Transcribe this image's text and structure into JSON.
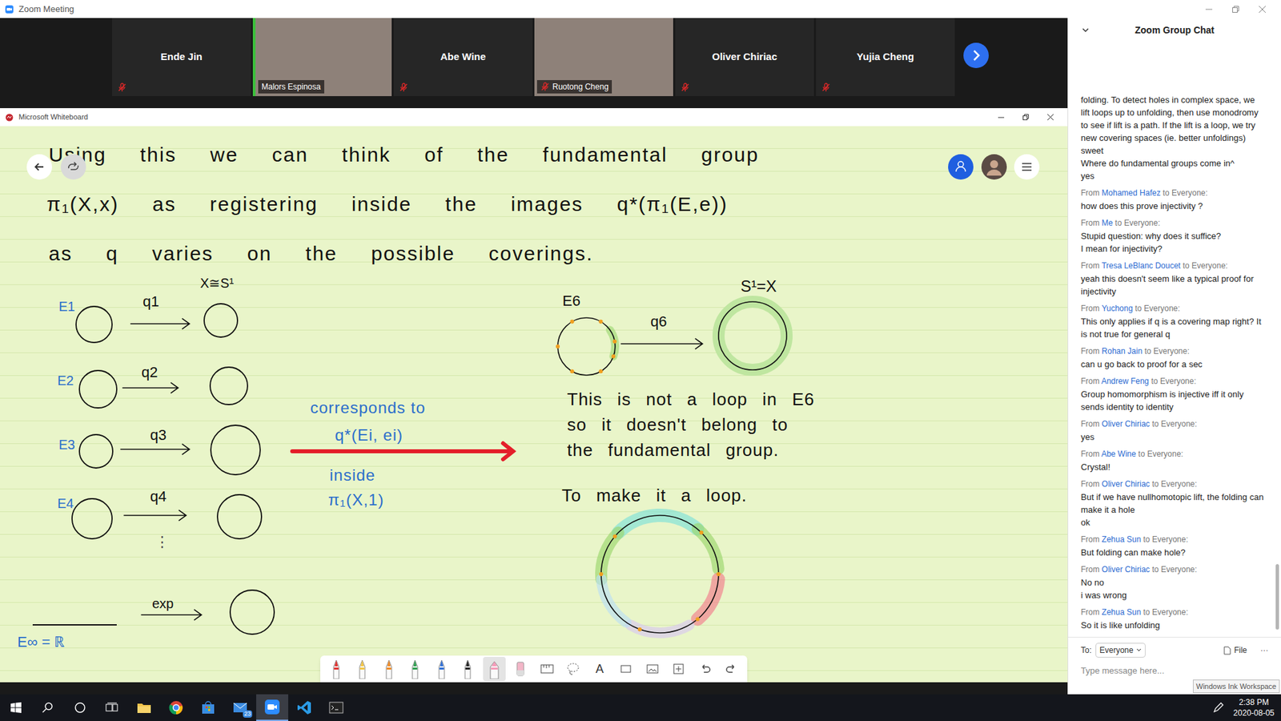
{
  "window": {
    "title": "Zoom Meeting"
  },
  "participants": [
    {
      "name": "Ende Jin",
      "kind": "name",
      "muted": true,
      "active_speaker": false
    },
    {
      "name": "Malors Espinosa",
      "kind": "video",
      "muted": false,
      "active_speaker": true
    },
    {
      "name": "Abe Wine",
      "kind": "name",
      "muted": true,
      "active_speaker": false
    },
    {
      "name": "Ruotong Cheng",
      "kind": "video",
      "muted": true,
      "active_speaker": false
    },
    {
      "name": "Oliver Chiriac",
      "kind": "name",
      "muted": true,
      "active_speaker": false
    },
    {
      "name": "Yujia Cheng",
      "kind": "name",
      "muted": true,
      "active_speaker": false
    }
  ],
  "whiteboard": {
    "title": "Microsoft Whiteboard",
    "heading_lines": [
      "Using this we can think of the fundamental group",
      "π₁(X,x) as registering inside the images q*(π₁(E,e))",
      "as q varies on the possible coverings."
    ],
    "coverings": [
      {
        "space": "E1",
        "map": "q1",
        "target_label": "X≅S¹"
      },
      {
        "space": "E2",
        "map": "q2"
      },
      {
        "space": "E3",
        "map": "q3"
      },
      {
        "space": "E4",
        "map": "q4"
      }
    ],
    "ellipsis": "⋮",
    "universal": {
      "space": "E∞ = ℝ",
      "map": "exp"
    },
    "note_lines": [
      "corresponds to",
      "q*(Ei, ei)",
      "inside",
      "π₁(X,1)"
    ],
    "example": {
      "space": "E6",
      "map": "q6",
      "target": "S¹=X",
      "text_lines": [
        "This is not a loop in E6",
        "so it doesn't belong to",
        "the fundamental group."
      ],
      "prompt": "To make it a loop."
    },
    "tools": [
      {
        "kind": "pen",
        "color": "#e0312f",
        "selected": false
      },
      {
        "kind": "pen",
        "color": "#f4c542",
        "selected": false
      },
      {
        "kind": "pen",
        "color": "#f08a24",
        "selected": false
      },
      {
        "kind": "pen",
        "color": "#2e9e4f",
        "selected": false
      },
      {
        "kind": "pen",
        "color": "#2f6fd6",
        "selected": false
      },
      {
        "kind": "pen",
        "color": "#222222",
        "selected": false
      },
      {
        "kind": "highlighter",
        "color": "#f59ab8",
        "selected": true
      },
      {
        "kind": "eraser",
        "selected": false
      },
      {
        "kind": "ruler",
        "selected": false
      },
      {
        "kind": "lasso",
        "selected": false
      },
      {
        "kind": "text",
        "label": "A",
        "selected": false
      },
      {
        "kind": "shape",
        "selected": false
      },
      {
        "kind": "image",
        "selected": false
      },
      {
        "kind": "add",
        "selected": false
      },
      {
        "kind": "undo",
        "selected": false
      },
      {
        "kind": "redo",
        "selected": false
      }
    ]
  },
  "chat": {
    "title": "Zoom Group Chat",
    "earlier": [
      "folding. To detect holes in complex space, we lift loops up to unfolding, then use monodromy to see if lift is a path. If the lift is a loop, we try new covering spaces (ie. better unfoldings)",
      "sweet",
      "Where do fundamental groups come in^",
      "yes"
    ],
    "messages": [
      {
        "from": "From",
        "sender": "Mohamed Hafez",
        "to": "to Everyone:",
        "lines": [
          "how does this prove injectivity ?"
        ]
      },
      {
        "from": "From",
        "sender": "Me",
        "to": "to Everyone:",
        "lines": [
          "Stupid question: why does it suffice?",
          "I mean for injectivity?"
        ]
      },
      {
        "from": "From",
        "sender": "Tresa LeBlanc Doucet",
        "to": "to Everyone:",
        "lines": [
          "yeah this doesn't seem like a typical proof for injectivity"
        ]
      },
      {
        "from": "From",
        "sender": "Yuchong",
        "to": "to Everyone:",
        "lines": [
          "This only applies if q is a covering map right? It is not true for general q"
        ]
      },
      {
        "from": "From",
        "sender": "Rohan Jain",
        "to": "to Everyone:",
        "lines": [
          "can u go back to proof for a sec"
        ]
      },
      {
        "from": "From",
        "sender": "Andrew Feng",
        "to": "to Everyone:",
        "lines": [
          "Group homomorphism is injective iff it only sends identity to identity"
        ]
      },
      {
        "from": "From",
        "sender": "Oliver Chiriac",
        "to": "to Everyone:",
        "lines": [
          "yes"
        ]
      },
      {
        "from": "From",
        "sender": "Abe Wine",
        "to": "to Everyone:",
        "lines": [
          "Crystal!"
        ]
      },
      {
        "from": "From",
        "sender": "Oliver Chiriac",
        "to": "to Everyone:",
        "lines": [
          "But if we have nullhomotopic lift, the folding can make it a hole",
          "ok"
        ]
      },
      {
        "from": "From",
        "sender": "Zehua Sun",
        "to": "to Everyone:",
        "lines": [
          "But folding can make hole?"
        ]
      },
      {
        "from": "From",
        "sender": "Oliver Chiriac",
        "to": "to Everyone:",
        "lines": [
          "No no",
          "i was wrong"
        ]
      },
      {
        "from": "From",
        "sender": "Zehua Sun",
        "to": "to Everyone:",
        "lines": [
          "So it is like unfolding"
        ]
      }
    ],
    "to_label": "To:",
    "recipient": "Everyone",
    "file": "File",
    "more": "···",
    "placeholder": "Type message here...",
    "ink_tooltip": "Windows Ink Workspace"
  },
  "taskbar": {
    "mail_badge": "23",
    "time": "2:38 PM",
    "date": "2020-08-05"
  }
}
